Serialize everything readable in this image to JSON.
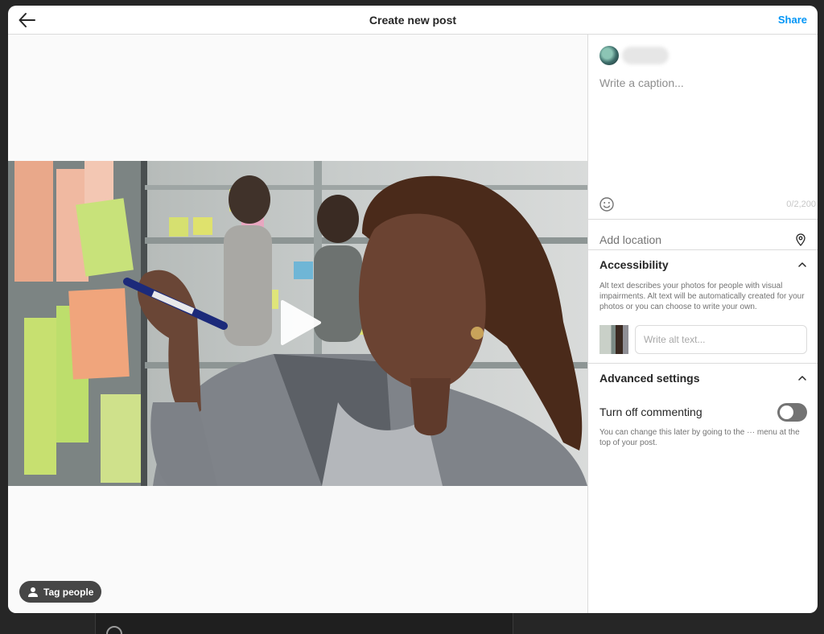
{
  "header": {
    "title": "Create new post",
    "share_label": "Share"
  },
  "media": {
    "tag_people_label": "Tag people"
  },
  "caption": {
    "placeholder": "Write a caption...",
    "char_count": "0/2,200"
  },
  "location": {
    "placeholder": "Add location"
  },
  "accessibility": {
    "title": "Accessibility",
    "description": "Alt text describes your photos for people with visual impairments. Alt text will be automatically created for your photos or you can choose to write your own.",
    "alt_placeholder": "Write alt text..."
  },
  "advanced": {
    "title": "Advanced settings",
    "commenting_label": "Turn off commenting",
    "commenting_off": false,
    "commenting_note": "You can change this later by going to the ··· menu at the top of your post."
  },
  "colors": {
    "accent": "#0095f6",
    "toggle_off": "#737373"
  }
}
